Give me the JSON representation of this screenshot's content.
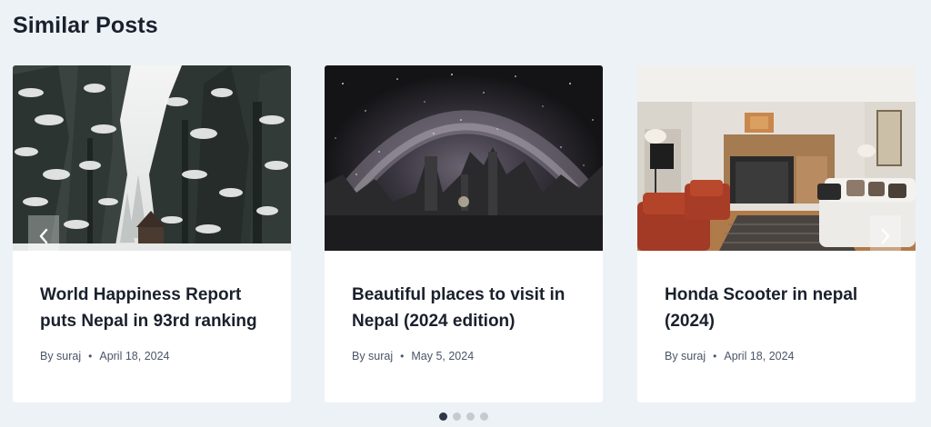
{
  "section": {
    "title": "Similar Posts"
  },
  "posts": [
    {
      "title": "World Happiness Report puts Nepal in 93rd ranking",
      "author": "By suraj",
      "date": "April 18, 2024",
      "image": "snowy-forest-cabin"
    },
    {
      "title": "Beautiful places to visit in Nepal (2024 edition)",
      "author": "By suraj",
      "date": "May 5, 2024",
      "image": "milky-way-night-sky"
    },
    {
      "title": "Honda Scooter in nepal (2024)",
      "author": "By suraj",
      "date": "April 18, 2024",
      "image": "living-room-fireplace"
    }
  ],
  "carousel": {
    "dot_count": 4,
    "active_dot": 1
  },
  "icons": {
    "prev": "chevron-left-icon",
    "next": "chevron-right-icon"
  },
  "colors": {
    "background": "#edf2f7",
    "card": "#ffffff",
    "text": "#1a202c",
    "meta": "#4a5568",
    "dot_active": "#2d3748",
    "dot_inactive": "#c5cad2"
  }
}
